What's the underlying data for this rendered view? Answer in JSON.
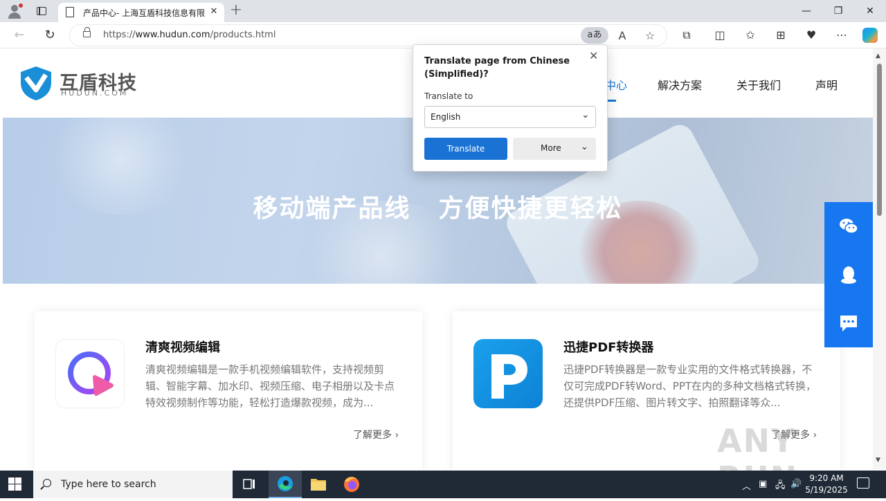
{
  "browser": {
    "tab_title": "产品中心- 上海互盾科技信息有限",
    "url_prefix": "https://",
    "url_host": "www.hudun.com",
    "url_path": "/products.html",
    "translate_badge": "aあ"
  },
  "site": {
    "logo_text": "互盾科技",
    "logo_sub": "HUDUN.COM",
    "nav": [
      {
        "label": "中心",
        "active": true
      },
      {
        "label": "解决方案"
      },
      {
        "label": "关于我们"
      },
      {
        "label": "声明"
      }
    ],
    "banner": {
      "line1": "移动端产品线",
      "line2": "方便快捷更轻松"
    },
    "products": [
      {
        "title": "清爽视频编辑",
        "desc": "清爽视频编辑是一款手机视频编辑软件，支持视频剪辑、智能字幕、加水印、视频压缩、电子相册以及卡点特效视频制作等功能，轻松打造爆款视频，成为...",
        "more": "了解更多"
      },
      {
        "title": "迅捷PDF转换器",
        "desc": "迅捷PDF转换器是一款专业实用的文件格式转换器，不仅可完成PDF转Word、PPT在内的多种文档格式转换，还提供PDF压缩、图片转文字、拍照翻译等众...",
        "more": "了解更多"
      }
    ]
  },
  "translate_popup": {
    "title": "Translate page from Chinese (Simplified)?",
    "label": "Translate to",
    "language": "English",
    "translate_button": "Translate",
    "more_button": "More"
  },
  "watermark": "ANY RUN",
  "taskbar": {
    "search_placeholder": "Type here to search",
    "time": "9:20 AM",
    "date": "5/19/2025"
  },
  "colors": {
    "accent": "#1677f0",
    "translate_button": "#1a73d4",
    "taskbar": "#1f2a36"
  }
}
